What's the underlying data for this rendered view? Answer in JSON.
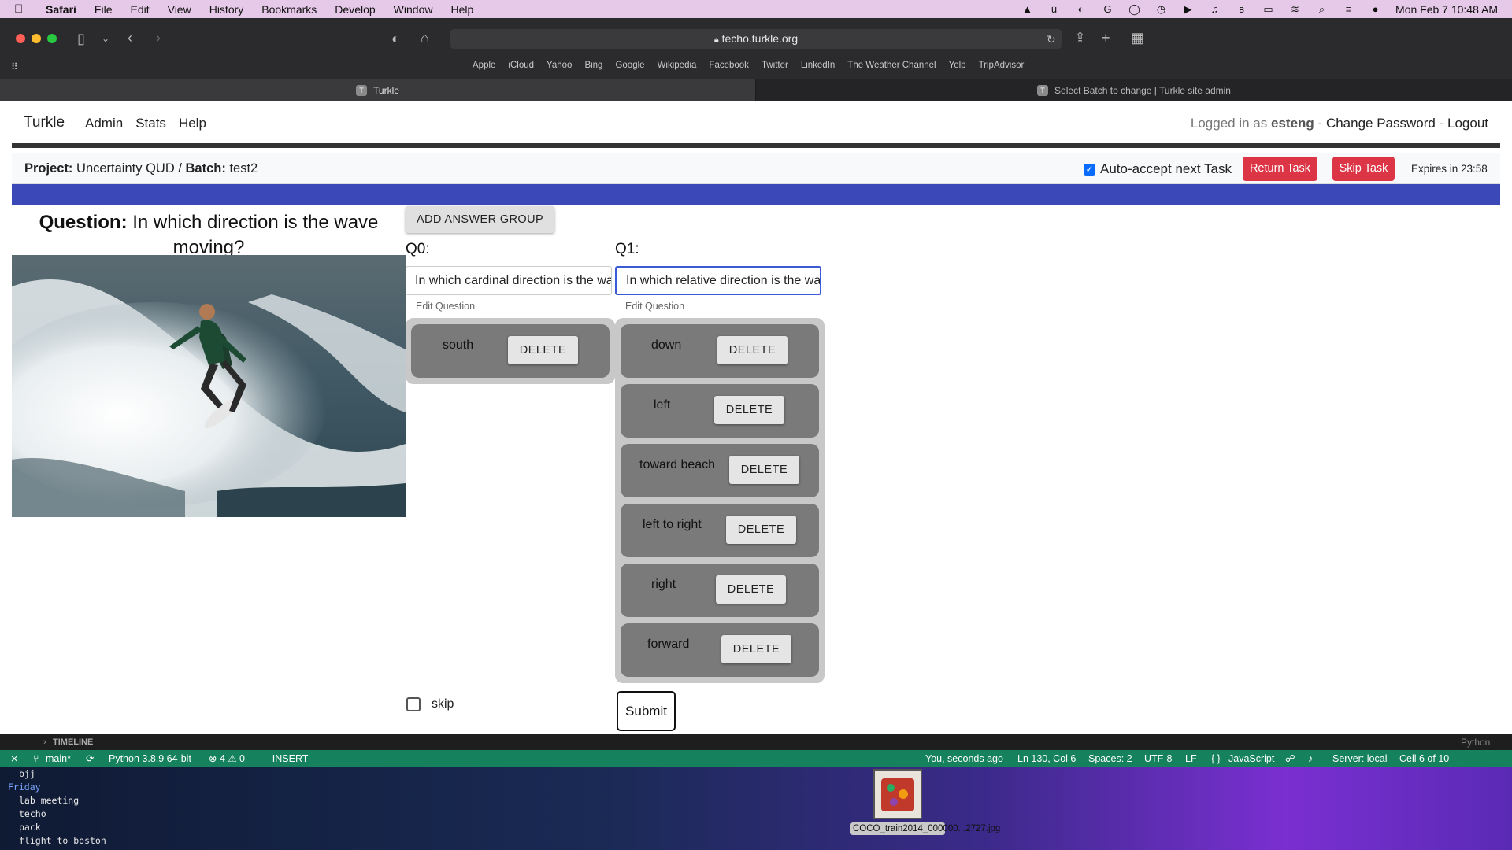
{
  "menubar": {
    "app": "Safari",
    "items": [
      "File",
      "Edit",
      "View",
      "History",
      "Bookmarks",
      "Develop",
      "Window",
      "Help"
    ],
    "clock": "Mon Feb 7  10:48 AM"
  },
  "safari": {
    "url": "techo.turkle.org",
    "favorites": [
      "Apple",
      "iCloud",
      "Yahoo",
      "Bing",
      "Google",
      "Wikipedia",
      "Facebook",
      "Twitter",
      "LinkedIn",
      "The Weather Channel",
      "Yelp",
      "TripAdvisor"
    ],
    "tabs": [
      {
        "label": "Turkle",
        "active": true
      },
      {
        "label": "Select Batch to change | Turkle site admin",
        "active": false
      }
    ]
  },
  "nav": {
    "brand": "Turkle",
    "links": [
      "Admin",
      "Stats",
      "Help"
    ],
    "logged_prefix": "Logged in as",
    "user": "esteng",
    "change_password": "Change Password",
    "logout": "Logout",
    "sep": "-"
  },
  "project": {
    "project_label": "Project:",
    "project_name": "Uncertainty QUD",
    "batch_label": "Batch:",
    "batch_name": "test2",
    "auto_accept": "Auto-accept next Task",
    "return_task": "Return Task",
    "skip_task": "Skip Task",
    "expires": "Expires in 23:58"
  },
  "task": {
    "question_label": "Question:",
    "question_text": "In which direction is the wave moving?",
    "add_answer_group": "ADD ANSWER GROUP",
    "q0": {
      "header": "Q0:",
      "value": "In which cardinal direction is the wave moving?",
      "edit_label": "Edit Question",
      "answers": [
        {
          "text": "south",
          "delete": "DELETE"
        }
      ]
    },
    "q1": {
      "header": "Q1:",
      "value": "In which relative direction is the wave moving?",
      "edit_label": "Edit Question",
      "answers": [
        {
          "text": "down",
          "delete": "DELETE"
        },
        {
          "text": "left",
          "delete": "DELETE"
        },
        {
          "text": "toward beach",
          "delete": "DELETE"
        },
        {
          "text": "left to right",
          "delete": "DELETE"
        },
        {
          "text": "right",
          "delete": "DELETE"
        },
        {
          "text": "forward",
          "delete": "DELETE"
        }
      ]
    },
    "skip_label": "skip",
    "submit": "Submit"
  },
  "vscode": {
    "timeline": "TIMELINE",
    "python_label": "Python",
    "branch": "main*",
    "interpreter": "Python 3.8.9 64-bit",
    "problems": "⊗ 4 ⚠ 0",
    "mode": "-- INSERT --",
    "blame": "You, seconds ago",
    "position": "Ln 130, Col 6",
    "spaces": "Spaces: 2",
    "encoding": "UTF-8",
    "eol": "LF",
    "language": "JavaScript",
    "server": "Server: local",
    "cell": "Cell 6 of 10"
  },
  "desktop": {
    "todo": {
      "top_item": "bjj",
      "day": "Friday",
      "items": [
        "lab meeting",
        "techo",
        "pack",
        "flight to boston"
      ]
    },
    "file_name": "COCO_train2014_000000...2727.jpg"
  }
}
